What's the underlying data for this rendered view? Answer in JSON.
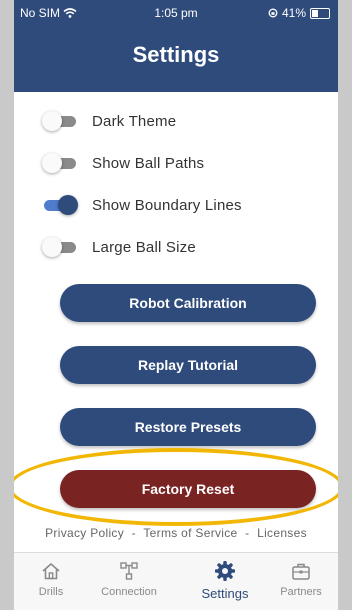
{
  "status_bar": {
    "carrier": "No SIM",
    "time": "1:05 pm",
    "battery": "41%"
  },
  "header": {
    "title": "Settings"
  },
  "toggles": [
    {
      "label": "Dark Theme",
      "on": false
    },
    {
      "label": "Show Ball Paths",
      "on": false
    },
    {
      "label": "Show Boundary Lines",
      "on": true
    },
    {
      "label": "Large Ball Size",
      "on": false
    }
  ],
  "buttons": {
    "robot_calibration": "Robot Calibration",
    "replay_tutorial": "Replay Tutorial",
    "restore_presets": "Restore Presets",
    "factory_reset": "Factory Reset"
  },
  "links": {
    "privacy": "Privacy Policy",
    "terms": "Terms of Service",
    "licenses": "Licenses",
    "separator": "-"
  },
  "nav": [
    {
      "label": "Drills",
      "icon": "home-icon"
    },
    {
      "label": "Connection",
      "icon": "connection-icon"
    },
    {
      "label": "Settings",
      "icon": "gear-icon",
      "active": true
    },
    {
      "label": "Partners",
      "icon": "briefcase-icon"
    }
  ],
  "colors": {
    "primary": "#2f4b7c",
    "danger": "#7a2323",
    "highlight": "#f2b705",
    "toggle_on_track": "#4f7ccc"
  }
}
